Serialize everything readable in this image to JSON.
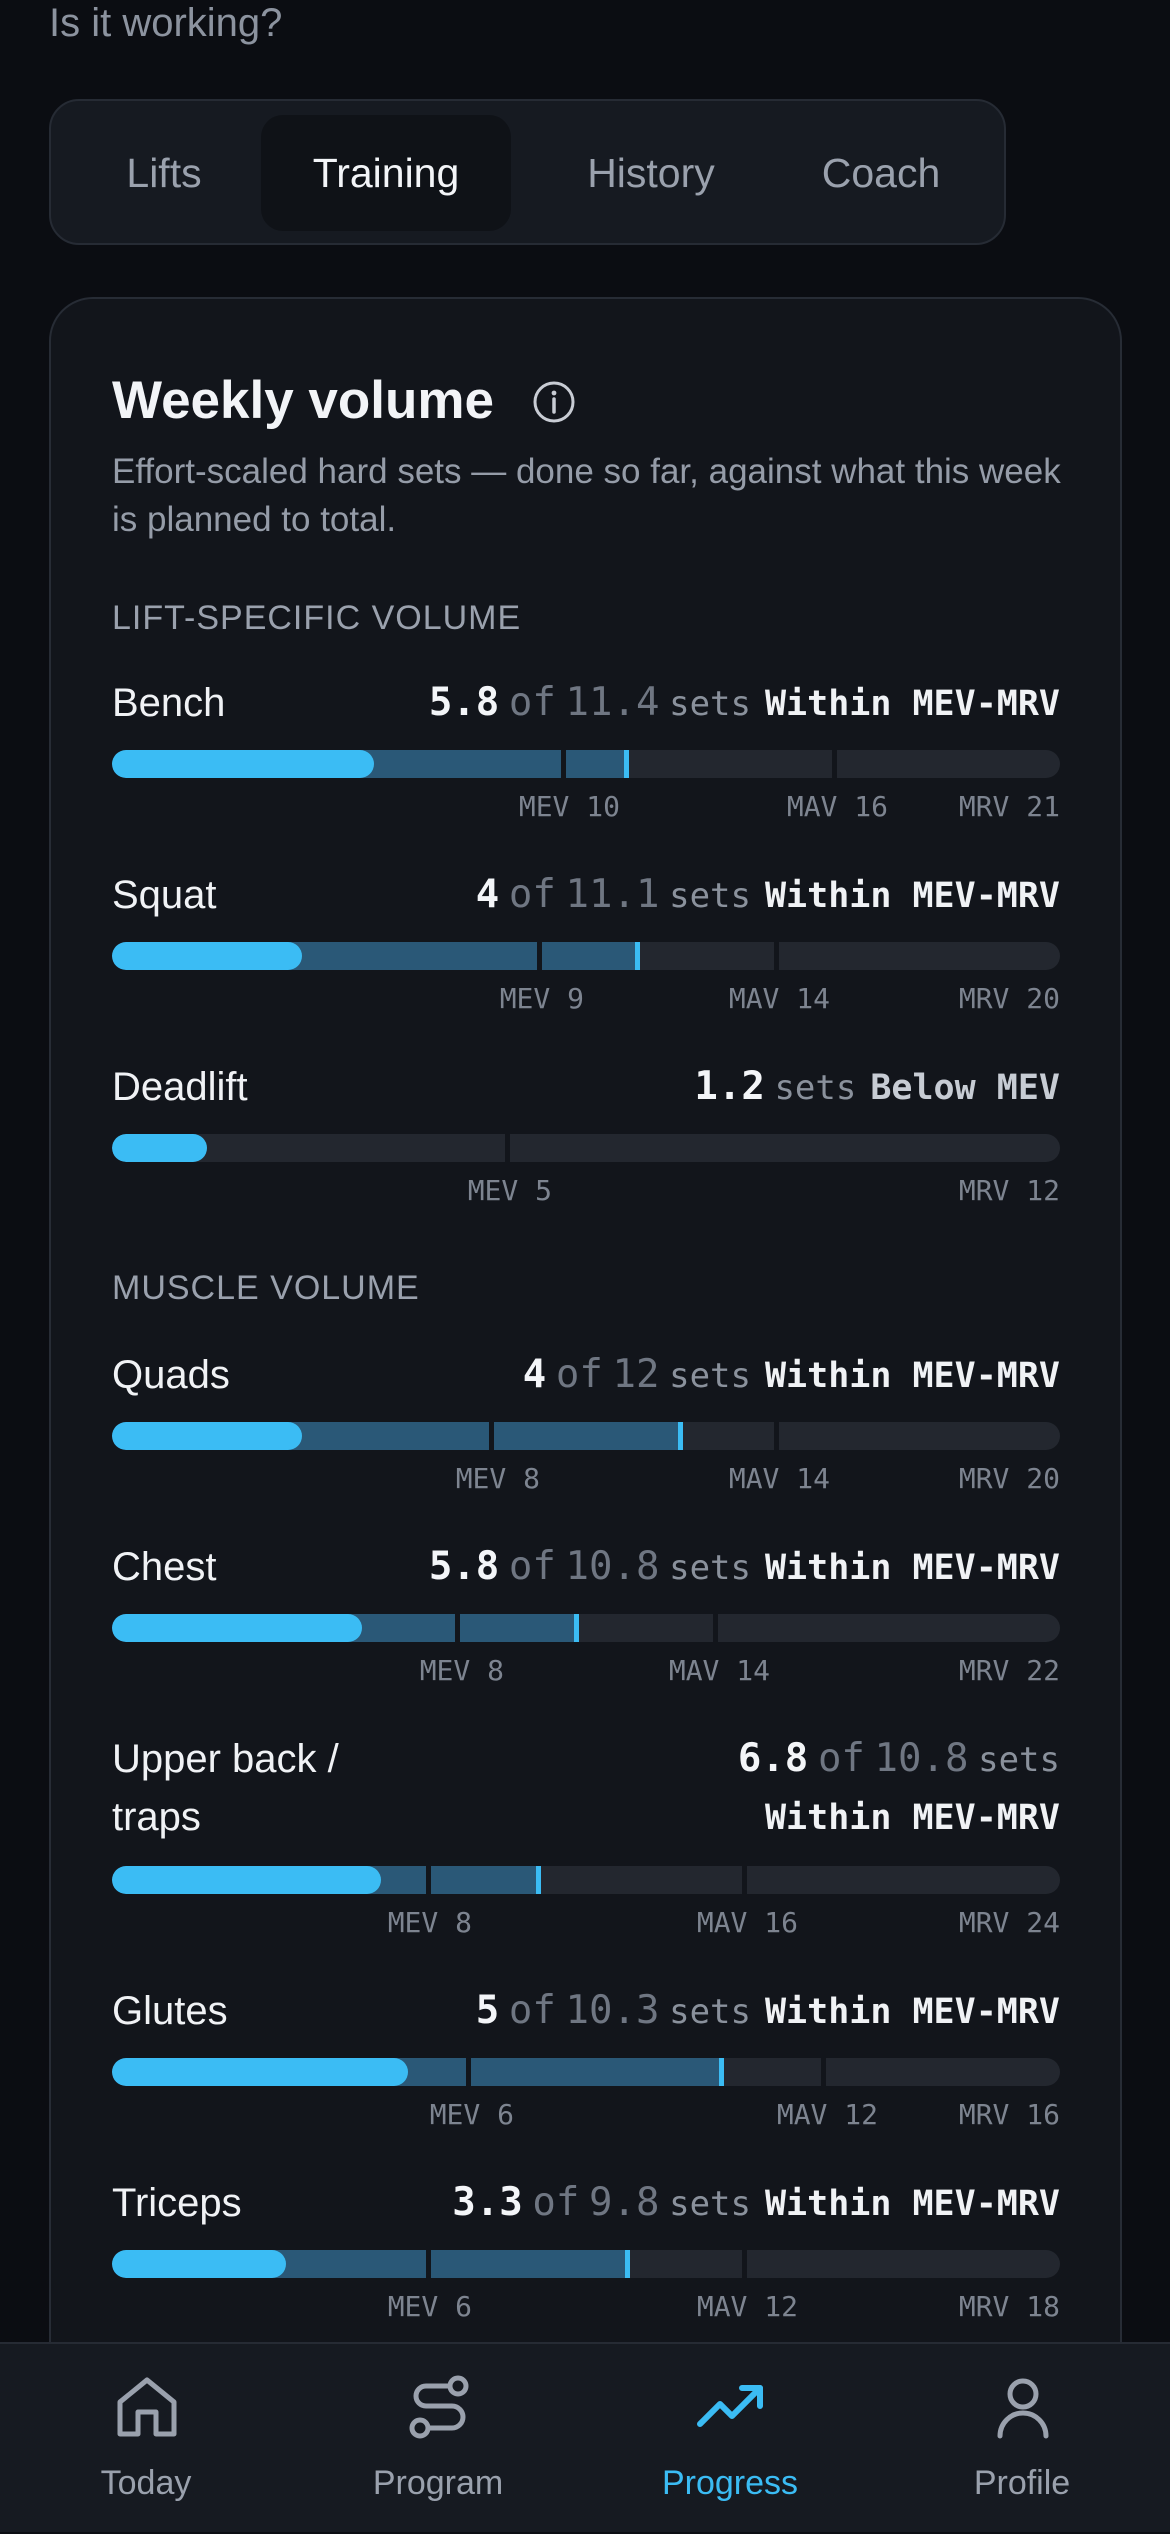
{
  "header": {
    "subtitle": "Is it working?"
  },
  "tabs": [
    {
      "label": "Lifts",
      "active": false
    },
    {
      "label": "Training",
      "active": true
    },
    {
      "label": "History",
      "active": false
    },
    {
      "label": "Coach",
      "active": false
    }
  ],
  "card": {
    "title": "Weekly volume",
    "description": "Effort-scaled hard sets — done so far, against what this week is planned to total.",
    "sections": [
      {
        "label": "LIFT-SPECIFIC VOLUME"
      },
      {
        "label": "MUSCLE VOLUME"
      }
    ]
  },
  "rows": [
    {
      "name": "Bench",
      "done": "5.8",
      "of": "of",
      "target": "11.4",
      "unit": "sets",
      "status": "Within MEV-MRV",
      "mev_label": "MEV 10",
      "mav_label": "MAV 16",
      "mrv_label": "MRV 21",
      "scale_max": 21,
      "mev": 10,
      "mav": 16,
      "mrv": 21,
      "done_value": 5.8,
      "target_value": 11.4
    },
    {
      "name": "Squat",
      "done": "4",
      "of": "of",
      "target": "11.1",
      "unit": "sets",
      "status": "Within MEV-MRV",
      "mev_label": "MEV 9",
      "mav_label": "MAV 14",
      "mrv_label": "MRV 20",
      "scale_max": 20,
      "mev": 9,
      "mav": 14,
      "mrv": 20,
      "done_value": 4,
      "target_value": 11.1
    },
    {
      "name": "Deadlift",
      "done": "1.2",
      "unit": "sets",
      "status": "Below MEV",
      "mev_label": "MEV 5",
      "mrv_label": "MRV 12",
      "scale_max": 12,
      "mev": 5,
      "mrv": 12,
      "done_value": 1.2
    },
    {
      "name": "Quads",
      "done": "4",
      "of": "of",
      "target": "12",
      "unit": "sets",
      "status": "Within MEV-MRV",
      "mev_label": "MEV 8",
      "mav_label": "MAV 14",
      "mrv_label": "MRV 20",
      "scale_max": 20,
      "mev": 8,
      "mav": 14,
      "mrv": 20,
      "done_value": 4,
      "target_value": 12
    },
    {
      "name": "Chest",
      "done": "5.8",
      "of": "of",
      "target": "10.8",
      "unit": "sets",
      "status": "Within MEV-MRV",
      "mev_label": "MEV 8",
      "mav_label": "MAV 14",
      "mrv_label": "MRV 22",
      "scale_max": 22,
      "mev": 8,
      "mav": 14,
      "mrv": 22,
      "done_value": 5.8,
      "target_value": 10.8
    },
    {
      "name": "Upper back / traps",
      "done": "6.8",
      "of": "of",
      "target": "10.8",
      "unit": "sets",
      "status": "Within MEV-MRV",
      "mev_label": "MEV 8",
      "mav_label": "MAV 16",
      "mrv_label": "MRV 24",
      "scale_max": 24,
      "mev": 8,
      "mav": 16,
      "mrv": 24,
      "done_value": 6.8,
      "target_value": 10.8
    },
    {
      "name": "Glutes",
      "done": "5",
      "of": "of",
      "target": "10.3",
      "unit": "sets",
      "status": "Within MEV-MRV",
      "mev_label": "MEV 6",
      "mav_label": "MAV 12",
      "mrv_label": "MRV 16",
      "scale_max": 16,
      "mev": 6,
      "mav": 12,
      "mrv": 16,
      "done_value": 5,
      "target_value": 10.3
    },
    {
      "name": "Triceps",
      "done": "3.3",
      "of": "of",
      "target": "9.8",
      "unit": "sets",
      "status": "Within MEV-MRV",
      "mev_label": "MEV 6",
      "mav_label": "MAV 12",
      "mrv_label": "MRV 18",
      "scale_max": 18,
      "mev": 6,
      "mav": 12,
      "mrv": 18,
      "done_value": 3.3,
      "target_value": 9.8
    }
  ],
  "nav": [
    {
      "label": "Today",
      "icon": "home-icon",
      "active": false
    },
    {
      "label": "Program",
      "icon": "route-icon",
      "active": false
    },
    {
      "label": "Progress",
      "icon": "trending-up-icon",
      "active": true
    },
    {
      "label": "Profile",
      "icon": "user-icon",
      "active": false
    }
  ],
  "colors": {
    "accent": "#3bbcf4",
    "planned": "#2a5877",
    "track": "#23272f"
  }
}
